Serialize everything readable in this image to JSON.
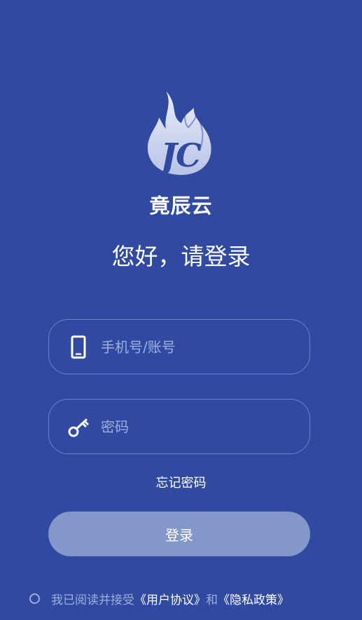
{
  "app": {
    "name": "竟辰云",
    "greeting": "您好，请登录"
  },
  "form": {
    "account_placeholder": "手机号/账号",
    "password_placeholder": "密码",
    "forgot_password": "忘记密码",
    "login_label": "登录"
  },
  "agreement": {
    "prefix": "我已阅读并接受",
    "user_agreement": "《用户协议》",
    "conjunction": "和",
    "privacy_policy": "《隐私政策》"
  },
  "icons": {
    "logo": "flame-jc-logo-icon",
    "account": "smartphone-icon",
    "password": "key-icon",
    "agree": "radio-circle-icon"
  },
  "colors": {
    "background": "#2f4aa0",
    "field_border": "#6d83c4",
    "placeholder": "#9fb0dc",
    "button": "#8397c9",
    "text": "#ffffff"
  }
}
